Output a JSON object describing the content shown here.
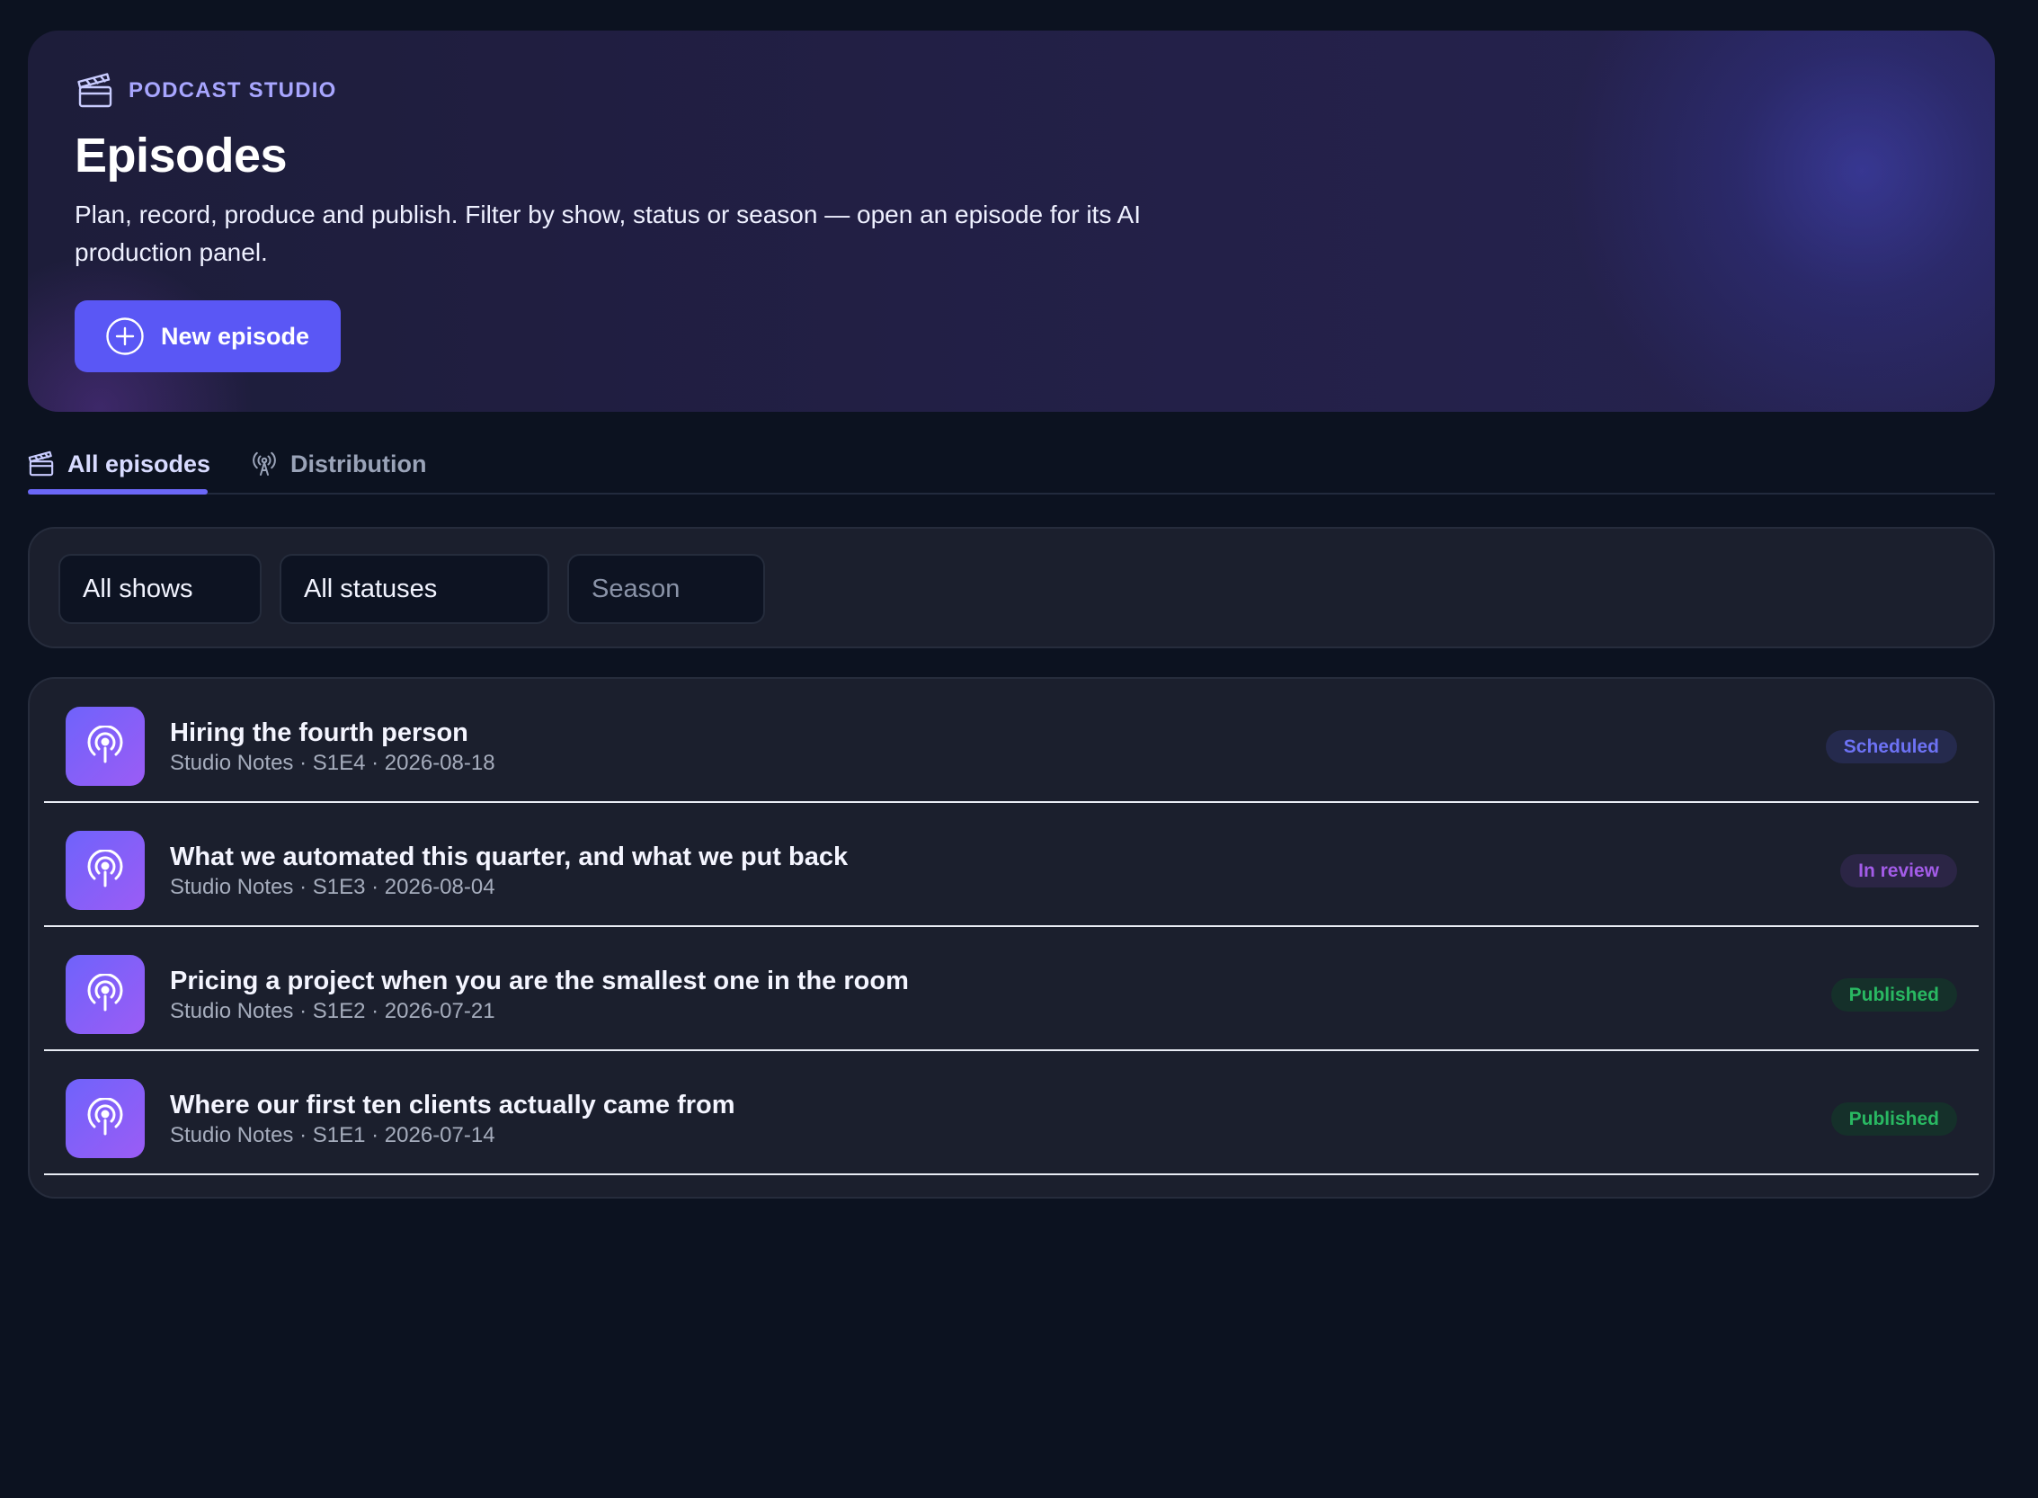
{
  "hero": {
    "eyebrow": "PODCAST STUDIO",
    "eyebrow_icon": "clapperboard-icon",
    "title": "Episodes",
    "description": "Plan, record, produce and publish. Filter by show, status or season — open an episode for its AI production panel.",
    "new_button_label": "New episode",
    "new_button_icon": "plus-circle-icon"
  },
  "tabs": [
    {
      "label": "All episodes",
      "icon": "clapperboard-icon",
      "active": true
    },
    {
      "label": "Distribution",
      "icon": "broadcast-icon",
      "active": false
    }
  ],
  "filters": {
    "show": "All shows",
    "status": "All statuses",
    "season_placeholder": "Season"
  },
  "episodes": [
    {
      "title": "Hiring the fourth person",
      "show": "Studio Notes",
      "code": "S1E4",
      "date": "2026-08-18",
      "status": "Scheduled",
      "icon": "podcast-icon"
    },
    {
      "title": "What we automated this quarter, and what we put back",
      "show": "Studio Notes",
      "code": "S1E3",
      "date": "2026-08-04",
      "status": "In review",
      "icon": "podcast-icon"
    },
    {
      "title": "Pricing a project when you are the smallest one in the room",
      "show": "Studio Notes",
      "code": "S1E2",
      "date": "2026-07-21",
      "status": "Published",
      "icon": "podcast-icon"
    },
    {
      "title": "Where our first ten clients actually came from",
      "show": "Studio Notes",
      "code": "S1E1",
      "date": "2026-07-14",
      "status": "Published",
      "icon": "podcast-icon"
    }
  ],
  "colors": {
    "accent": "#5a57f5",
    "background": "#0c1220",
    "panel": "#1b1f2d",
    "scheduled": "#6d72f4",
    "in_review": "#a35ce8",
    "published": "#29b862"
  }
}
